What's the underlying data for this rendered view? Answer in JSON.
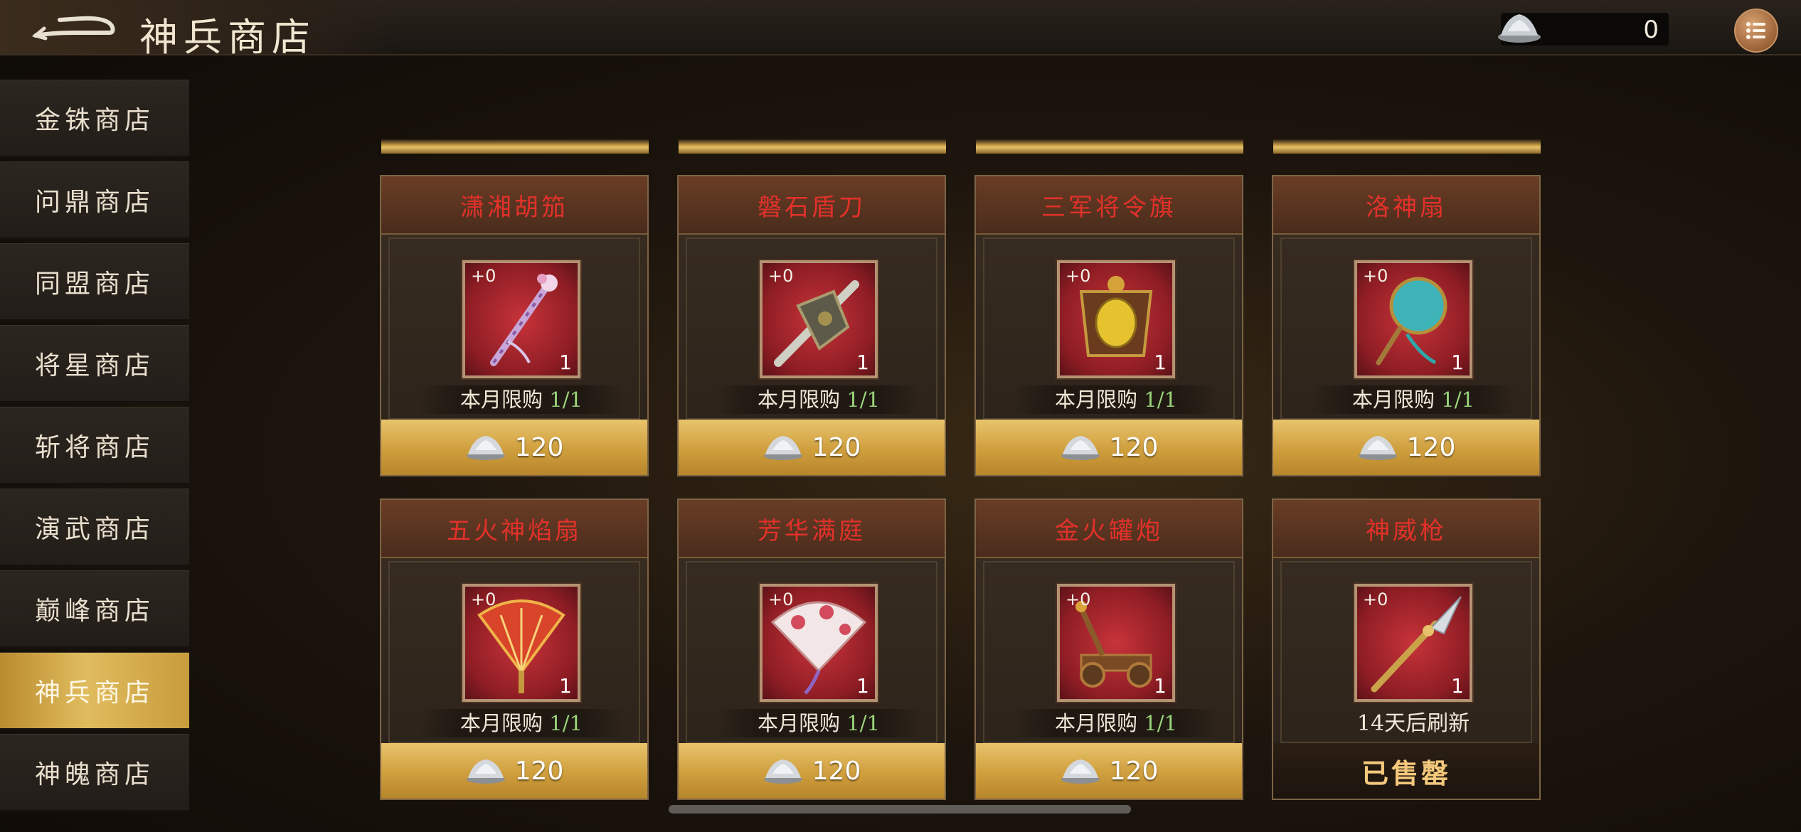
{
  "header": {
    "title": "神兵商店",
    "currency": {
      "icon": "silver-ingot-icon",
      "value": "0"
    }
  },
  "sidebar": {
    "items": [
      {
        "label": "金铢商店",
        "active": false
      },
      {
        "label": "问鼎商店",
        "active": false
      },
      {
        "label": "同盟商店",
        "active": false
      },
      {
        "label": "将星商店",
        "active": false
      },
      {
        "label": "斩将商店",
        "active": false
      },
      {
        "label": "演武商店",
        "active": false
      },
      {
        "label": "巅峰商店",
        "active": false
      },
      {
        "label": "神兵商店",
        "active": true
      },
      {
        "label": "神魄商店",
        "active": false
      }
    ]
  },
  "shop": {
    "items": [
      {
        "name": "潇湘胡笳",
        "plus": "+0",
        "qty": "1",
        "limit_prefix": "本月限购",
        "limit_value": "1/1",
        "price": "120",
        "art": "flute-staff-icon"
      },
      {
        "name": "磐石盾刀",
        "plus": "+0",
        "qty": "1",
        "limit_prefix": "本月限购",
        "limit_value": "1/1",
        "price": "120",
        "art": "shield-blade-icon"
      },
      {
        "name": "三军将令旗",
        "plus": "+0",
        "qty": "1",
        "limit_prefix": "本月限购",
        "limit_value": "1/1",
        "price": "120",
        "art": "command-banner-icon"
      },
      {
        "name": "洛神扇",
        "plus": "+0",
        "qty": "1",
        "limit_prefix": "本月限购",
        "limit_value": "1/1",
        "price": "120",
        "art": "round-fan-icon"
      },
      {
        "name": "五火神焰扇",
        "plus": "+0",
        "qty": "1",
        "limit_prefix": "本月限购",
        "limit_value": "1/1",
        "price": "120",
        "art": "feather-fan-icon"
      },
      {
        "name": "芳华满庭",
        "plus": "+0",
        "qty": "1",
        "limit_prefix": "本月限购",
        "limit_value": "1/1",
        "price": "120",
        "art": "folding-fan-icon"
      },
      {
        "name": "金火罐炮",
        "plus": "+0",
        "qty": "1",
        "limit_prefix": "本月限购",
        "limit_value": "1/1",
        "price": "120",
        "art": "catapult-icon"
      },
      {
        "name": "神威枪",
        "plus": "+0",
        "qty": "1",
        "refresh_text": "14天后刷新",
        "sold_out_label": "已售罄",
        "art": "spear-icon"
      }
    ]
  },
  "colors": {
    "item_name": "#e2312a",
    "limit_highlight": "#9ad47a",
    "gold_bar": "#cf9e3d",
    "sidebar_active": "#d4ad4c"
  }
}
